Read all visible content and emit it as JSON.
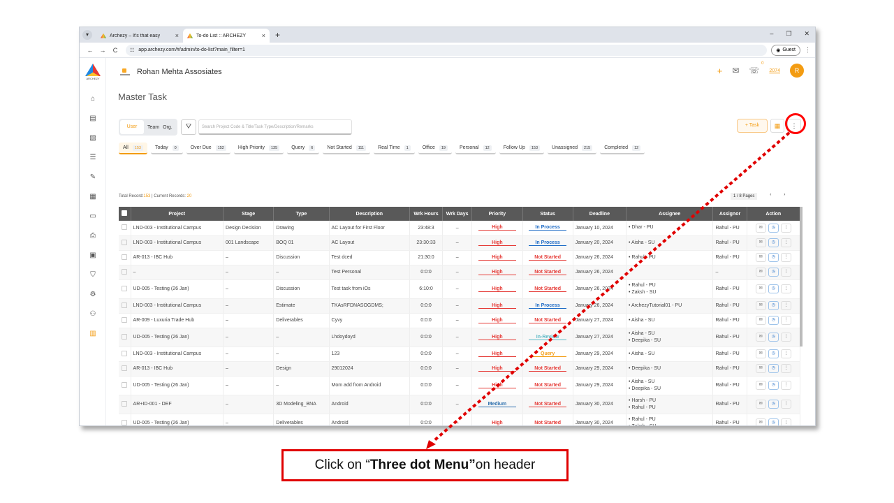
{
  "browser": {
    "tabs": [
      {
        "title": "Archezy – It's that easy",
        "active": false
      },
      {
        "title": "To-do List :: ARCHEZY",
        "active": true
      }
    ],
    "url": "app.archezy.com/#/admin/to-do-list?main_filter=1",
    "guest_label": "Guest"
  },
  "app": {
    "brand_text": "ARCHEZY",
    "org_name": "Rohan Mehta Assosiates",
    "notif_count": "0",
    "points": "2074",
    "avatar_initial": "R",
    "page_title": "Master Task"
  },
  "toolbar": {
    "toggle_user": "User",
    "toggle_team": "Team",
    "toggle_org": "Org.",
    "search_placeholder": "Search Project Code & Title/Task Type/Description/Remarks",
    "add_task_label": "Task"
  },
  "chips": [
    {
      "label": "All",
      "count": "153",
      "active": true
    },
    {
      "label": "Today",
      "count": "0"
    },
    {
      "label": "Over Due",
      "count": "152"
    },
    {
      "label": "High Priority",
      "count": "135"
    },
    {
      "label": "Query",
      "count": "6"
    },
    {
      "label": "Not Started",
      "count": "111"
    },
    {
      "label": "Real Time",
      "count": "1"
    },
    {
      "label": "Office",
      "count": "19"
    },
    {
      "label": "Personal",
      "count": "12"
    },
    {
      "label": "Follow Up",
      "count": "153"
    },
    {
      "label": "Unassigned",
      "count": "215"
    },
    {
      "label": "Completed",
      "count": "12"
    }
  ],
  "records": {
    "prefix": "Total Record:",
    "total": "153",
    "mid": " | Current Records: ",
    "current": "20"
  },
  "pager": {
    "label": "1 / 8 Pages",
    "prev": "‹",
    "next": "›"
  },
  "table": {
    "headers": [
      "Project",
      "Stage",
      "Type",
      "Description",
      "Wrk Hours",
      "Wrk Days",
      "Priority",
      "Status",
      "Deadline",
      "Assignee",
      "Assignor",
      "Action"
    ],
    "rows": [
      {
        "project": "LND-003 - Institutional Campus",
        "stage": "Design Decision",
        "type": "Drawing",
        "desc": "AC Layout for First Floor",
        "hours": "23:48:3",
        "days": "–",
        "priority": "High",
        "status": "In Process",
        "deadline": "January 10, 2024",
        "assignee": [
          "Dhar - PU"
        ],
        "assignor": "Rahul - PU"
      },
      {
        "project": "LND-003 - Institutional Campus",
        "stage": "001 Landscape",
        "type": "BOQ 01",
        "desc": "AC Layout",
        "hours": "23:30:33",
        "days": "–",
        "priority": "High",
        "status": "In Process",
        "deadline": "January 20, 2024",
        "assignee": [
          "Aisha - SU"
        ],
        "assignor": "Rahul - PU"
      },
      {
        "project": "AR-013 - IBC Hub",
        "stage": "–",
        "type": "Discussion",
        "desc": "Test dced",
        "hours": "21:30:0",
        "days": "–",
        "priority": "High",
        "status": "Not Started",
        "deadline": "January 26, 2024",
        "assignee": [
          "Rahul - PU"
        ],
        "assignor": "Rahul - PU"
      },
      {
        "project": "–",
        "stage": "–",
        "type": "–",
        "desc": "Test Personal",
        "hours": "0:0:0",
        "days": "–",
        "priority": "High",
        "status": "Not Started",
        "deadline": "January 26, 2024",
        "assignee": [],
        "assignor": "–"
      },
      {
        "project": "UD-005 - Testing (26 Jan)",
        "stage": "–",
        "type": "Discussion",
        "desc": "Test task from iOs",
        "hours": "6:10:0",
        "days": "–",
        "priority": "High",
        "status": "Not Started",
        "deadline": "January 26, 2024",
        "assignee": [
          "Rahul - PU",
          "Zaksh - SU"
        ],
        "assignor": "Rahul - PU"
      },
      {
        "project": "LND-003 - Institutional Campus",
        "stage": "–",
        "type": "Estimate",
        "desc": "TKAsRFDNASOGDMS;",
        "hours": "0:0:0",
        "days": "–",
        "priority": "High",
        "status": "In Process",
        "deadline": "January 26, 2024",
        "assignee": [
          "ArchezyTutorial01 - PU"
        ],
        "assignor": "Rahul - PU"
      },
      {
        "project": "AR-009 - Luxuria Trade Hub",
        "stage": "–",
        "type": "Deliverables",
        "desc": "Cyvy",
        "hours": "0:0:0",
        "days": "–",
        "priority": "High",
        "status": "Not Started",
        "deadline": "January 27, 2024",
        "assignee": [
          "Aisha - SU"
        ],
        "assignor": "Rahul - PU"
      },
      {
        "project": "UD-005 - Testing (26 Jan)",
        "stage": "–",
        "type": "–",
        "desc": "Lhdoydoyd",
        "hours": "0:0:0",
        "days": "–",
        "priority": "High",
        "status": "In-Review",
        "deadline": "January 27, 2024",
        "assignee": [
          "Aisha - SU",
          "Deepika - SU"
        ],
        "assignor": "Rahul - PU"
      },
      {
        "project": "LND-003 - Institutional Campus",
        "stage": "–",
        "type": "–",
        "desc": "123",
        "hours": "0:0:0",
        "days": "–",
        "priority": "High",
        "status": "Query",
        "deadline": "January 29, 2024",
        "assignee": [
          "Aisha - SU"
        ],
        "assignor": "Rahul - PU"
      },
      {
        "project": "AR-013 - IBC Hub",
        "stage": "–",
        "type": "Design",
        "desc": "29012024",
        "hours": "0:0:0",
        "days": "–",
        "priority": "High",
        "status": "Not Started",
        "deadline": "January 29, 2024",
        "assignee": [
          "Deepika - SU"
        ],
        "assignor": "Rahul - PU"
      },
      {
        "project": "UD-005 - Testing (26 Jan)",
        "stage": "–",
        "type": "–",
        "desc": "Mom add from Android",
        "hours": "0:0:0",
        "days": "–",
        "priority": "High",
        "status": "Not Started",
        "deadline": "January 29, 2024",
        "assignee": [
          "Aisha - SU",
          "Deepika - SU"
        ],
        "assignor": "Rahul - PU"
      },
      {
        "project": "AR+ID-001 - DEF",
        "stage": "–",
        "type": "3D Modeling_BNA",
        "desc": "Android",
        "hours": "0:0:0",
        "days": "–",
        "priority": "Medium",
        "status": "Not Started",
        "deadline": "January 30, 2024",
        "assignee": [
          "Harsh - PU",
          "Rahul - PU"
        ],
        "assignor": "Rahul - PU"
      },
      {
        "project": "UD-005 - Testing (26 Jan)",
        "stage": "–",
        "type": "Deliverables",
        "desc": "Android",
        "hours": "0:0:0",
        "days": "–",
        "priority": "High",
        "status": "Not Started",
        "deadline": "January 30, 2024",
        "assignee": [
          "Rahul - PU",
          "Zaksh - SU"
        ],
        "assignor": "Rahul - PU"
      }
    ]
  },
  "annotation": {
    "callout_prefix": "Click on “",
    "callout_bold": "Three dot Menu”",
    "callout_suffix": " on header",
    "color": "#e00000"
  }
}
